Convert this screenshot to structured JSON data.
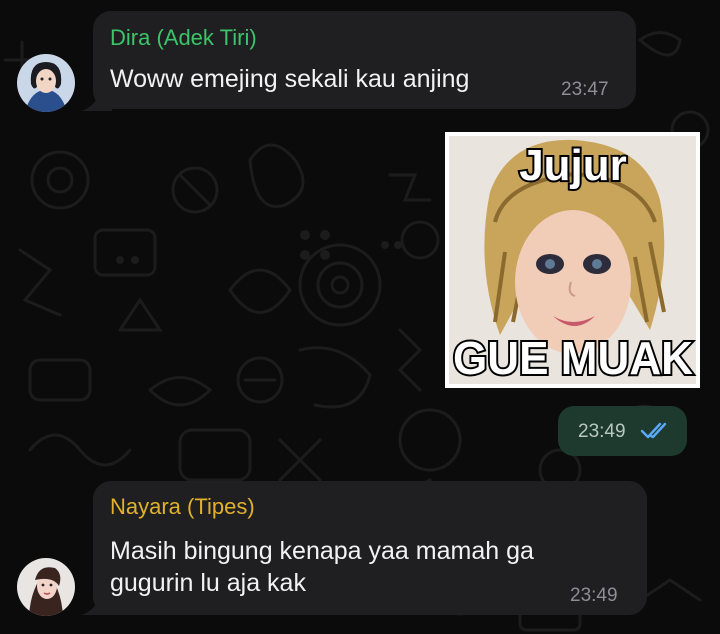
{
  "messages": [
    {
      "sender": "Dira (Adek Tiri)",
      "sender_color": "#3cc46a",
      "text": "Woww emejing sekali kau anjing",
      "time": "23:47"
    },
    {
      "type": "sticker",
      "sticker_top_text": "Jujur",
      "sticker_bottom_text": "GUE MUAK",
      "time": "23:49",
      "status": "read"
    },
    {
      "sender": "Nayara (Tipes)",
      "sender_color": "#e2b12b",
      "text_line1": "Masih bingung kenapa yaa mamah ga",
      "text_line2": "gugurin lu aja kak",
      "time": "23:49"
    }
  ],
  "colors": {
    "background": "#0b0b0b",
    "incoming_bubble": "#1f1f21",
    "outgoing_pill": "#1e3a2f",
    "read_ticks": "#5aa9ff"
  }
}
